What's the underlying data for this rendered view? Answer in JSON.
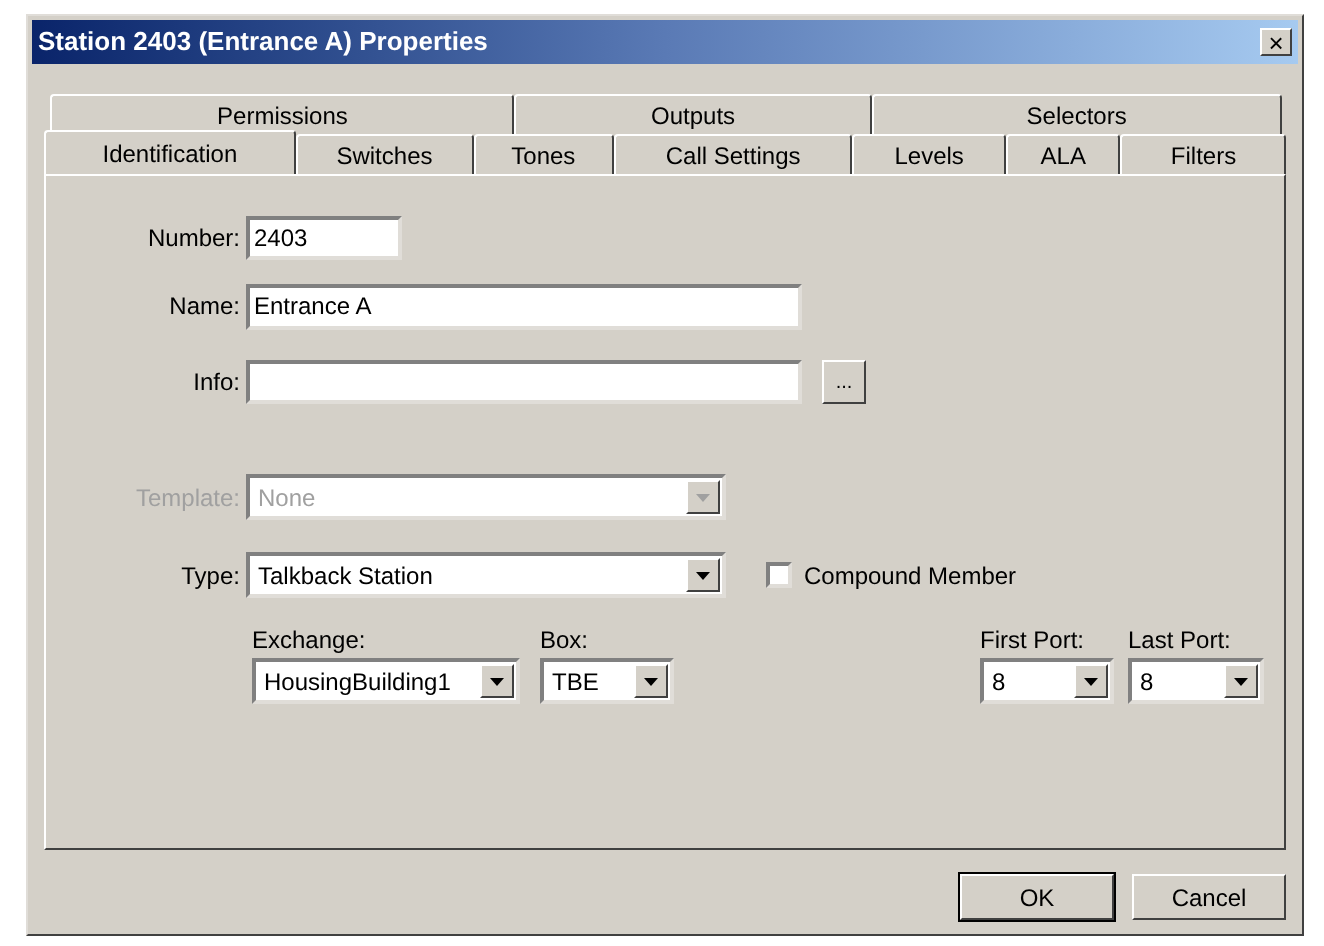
{
  "window": {
    "title": "Station 2403 (Entrance A) Properties",
    "close": "×"
  },
  "tab_rows": [
    [
      {
        "label": "Permissions",
        "selected": false
      },
      {
        "label": "Outputs",
        "selected": false
      },
      {
        "label": "Selectors",
        "selected": false
      }
    ],
    [
      {
        "label": "Identification",
        "selected": true
      },
      {
        "label": "Switches",
        "selected": false
      },
      {
        "label": "Tones",
        "selected": false
      },
      {
        "label": "Call Settings",
        "selected": false
      },
      {
        "label": "Levels",
        "selected": false
      },
      {
        "label": "ALA",
        "selected": false
      },
      {
        "label": "Filters",
        "selected": false
      }
    ]
  ],
  "number": {
    "label": "Number:",
    "value": "2403"
  },
  "name": {
    "label": "Name:",
    "value": "Entrance A"
  },
  "info": {
    "label": "Info:",
    "button": "..."
  },
  "template": {
    "label": "Template:",
    "value": "None",
    "disabled": true
  },
  "type": {
    "label": "Type:",
    "value": "Talkback Station",
    "disabled": false
  },
  "compound_member": {
    "label": "Compound Member",
    "checked": false
  },
  "exchange": {
    "label": "Exchange:",
    "value": "HousingBuilding1"
  },
  "box": {
    "label": "Box:",
    "value": "TBE"
  },
  "first_port": {
    "label": "First Port:",
    "value": "8"
  },
  "last_port": {
    "label": "Last Port:",
    "value": "8"
  },
  "buttons": [
    {
      "label": "OK",
      "default": true
    },
    {
      "label": "Cancel",
      "default": false
    }
  ]
}
